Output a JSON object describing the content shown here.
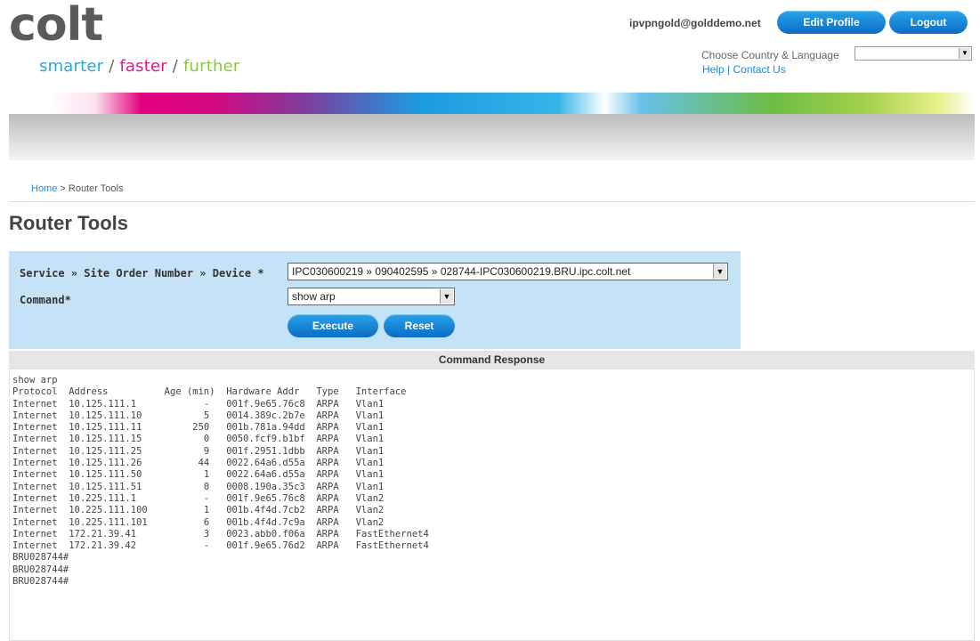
{
  "header": {
    "logo_text": "colt",
    "tagline": {
      "a": "smarter",
      "sep1": " / ",
      "b": "faster",
      "sep2": " / ",
      "c": "further"
    },
    "user_email": "ipvpngold@golddemo.net",
    "edit_profile": "Edit Profile",
    "logout": "Logout",
    "country_label": "Choose Country & Language",
    "country_value": "",
    "help": "Help",
    "links_sep": " | ",
    "contact": "Contact Us"
  },
  "breadcrumb": {
    "home": "Home",
    "sep": " > ",
    "current": "Router Tools"
  },
  "page_title": "Router Tools",
  "form": {
    "device_label": "Service » Site Order Number » Device ",
    "device_required": "*",
    "device_value": "IPC030600219 » 090402595 » 028744-IPC030600219.BRU.ipc.colt.net",
    "command_label": "Command",
    "command_required": "*",
    "command_value": "show arp",
    "execute": "Execute",
    "reset": "Reset"
  },
  "response": {
    "header": "Command Response",
    "text": "show arp\nProtocol  Address          Age (min)  Hardware Addr   Type   Interface\nInternet  10.125.111.1            -   001f.9e65.76c8  ARPA   Vlan1\nInternet  10.125.111.10           5   0014.389c.2b7e  ARPA   Vlan1\nInternet  10.125.111.11         250   001b.781a.94dd  ARPA   Vlan1\nInternet  10.125.111.15           0   0050.fcf9.b1bf  ARPA   Vlan1\nInternet  10.125.111.25           9   001f.2951.1dbb  ARPA   Vlan1\nInternet  10.125.111.26          44   0022.64a6.d55a  ARPA   Vlan1\nInternet  10.125.111.50           1   0022.64a6.d55a  ARPA   Vlan1\nInternet  10.125.111.51           0   0008.190a.35c3  ARPA   Vlan1\nInternet  10.225.111.1            -   001f.9e65.76c8  ARPA   Vlan2\nInternet  10.225.111.100          1   001b.4f4d.7cb2  ARPA   Vlan2\nInternet  10.225.111.101          6   001b.4f4d.7c9a  ARPA   Vlan2\nInternet  172.21.39.41            3   0023.abb0.f06a  ARPA   FastEthernet4\nInternet  172.21.39.42            -   001f.9e65.76d2  ARPA   FastEthernet4\nBRU028744#\nBRU028744#\nBRU028744#"
  },
  "icons": {
    "dropdown": "chevron-down-icon"
  },
  "colors": {
    "brand_gray": "#5b5b5b",
    "accent_blue": "#2fa4d6",
    "accent_pink": "#e11b83",
    "accent_green": "#8dc63f",
    "button_blue": "#0b6dc5",
    "form_bg": "#c6e2f7"
  }
}
